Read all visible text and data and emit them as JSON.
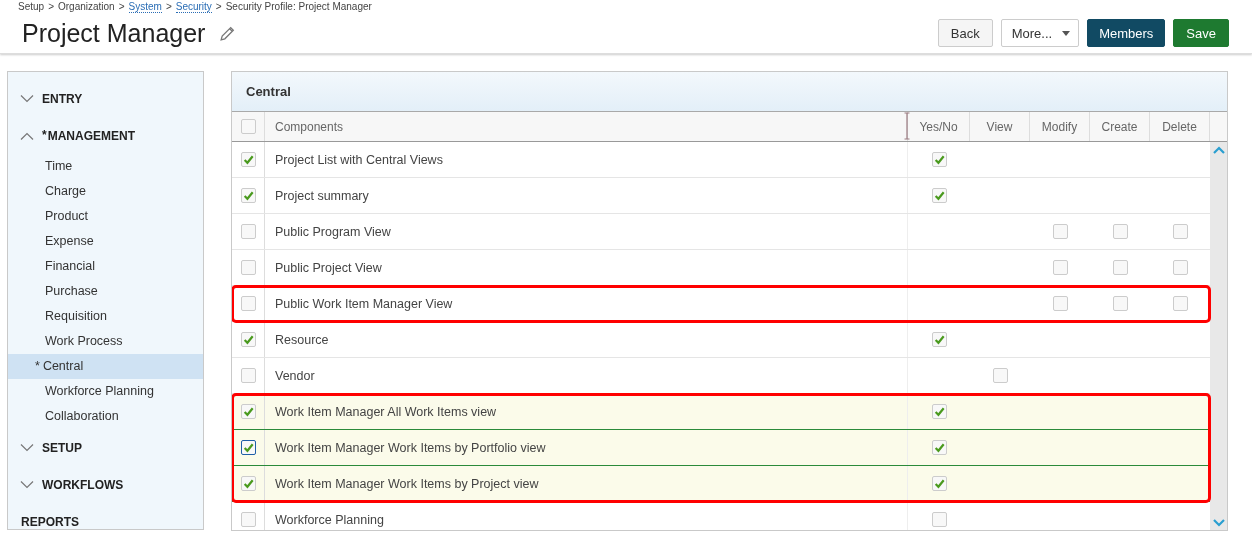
{
  "breadcrumb": {
    "separator": ">",
    "items": [
      {
        "label": "Setup",
        "link": false
      },
      {
        "label": "Organization",
        "link": false
      },
      {
        "label": "System",
        "link": true
      },
      {
        "label": "Security",
        "link": true
      },
      {
        "label": "Security Profile: Project Manager",
        "link": false
      }
    ]
  },
  "title": "Project Manager",
  "buttons": [
    {
      "label": "Back",
      "kind": "plain"
    },
    {
      "label": "More...",
      "kind": "dropdown"
    },
    {
      "label": "Members",
      "kind": "dark"
    },
    {
      "label": "Save",
      "kind": "primary"
    }
  ],
  "sidebar": [
    {
      "label": "ENTRY",
      "kind": "section",
      "expanded": false
    },
    {
      "label": "MANAGEMENT",
      "kind": "section",
      "expanded": true,
      "marker": "*",
      "items": [
        {
          "label": "Time",
          "selected": false
        },
        {
          "label": "Charge",
          "selected": false
        },
        {
          "label": "Product",
          "selected": false
        },
        {
          "label": "Expense",
          "selected": false
        },
        {
          "label": "Financial",
          "selected": false
        },
        {
          "label": "Purchase",
          "selected": false
        },
        {
          "label": "Requisition",
          "selected": false
        },
        {
          "label": "Work Process",
          "selected": false
        },
        {
          "label": "Central",
          "selected": true,
          "marker": "*"
        },
        {
          "label": "Workforce Planning",
          "selected": false
        },
        {
          "label": "Collaboration",
          "selected": false
        }
      ]
    },
    {
      "label": "SETUP",
      "kind": "section",
      "expanded": false
    },
    {
      "label": "WORKFLOWS",
      "kind": "section",
      "expanded": false
    },
    {
      "label": "REPORTS",
      "kind": "link"
    }
  ],
  "panel": {
    "title": "Central",
    "select_all": {
      "checked": false
    },
    "columns": [
      "Components",
      "Yes/No",
      "View",
      "Modify",
      "Create",
      "Delete"
    ],
    "row_groups": [
      {
        "outlined": false,
        "rows": [
          {
            "name": "Project List with Central Views",
            "checked": true,
            "highlighted": false,
            "focused": false,
            "yes_no": true
          },
          {
            "name": "Project summary",
            "checked": true,
            "highlighted": false,
            "focused": false,
            "yes_no": true
          },
          {
            "name": "Public Program View",
            "checked": false,
            "highlighted": false,
            "focused": false,
            "modify": false,
            "create": false,
            "delete": false
          },
          {
            "name": "Public Project View",
            "checked": false,
            "highlighted": false,
            "focused": false,
            "modify": false,
            "create": false,
            "delete": false
          }
        ]
      },
      {
        "outlined": true,
        "rows": [
          {
            "name": "Public Work Item Manager View",
            "checked": false,
            "highlighted": false,
            "focused": false,
            "modify": false,
            "create": false,
            "delete": false
          }
        ]
      },
      {
        "outlined": false,
        "rows": [
          {
            "name": "Resource",
            "checked": true,
            "highlighted": false,
            "focused": false,
            "yes_no": true
          },
          {
            "name": "Vendor",
            "checked": false,
            "highlighted": false,
            "focused": false,
            "view": false
          }
        ]
      },
      {
        "outlined": true,
        "rows": [
          {
            "name": "Work Item Manager All Work Items view",
            "checked": true,
            "highlighted": true,
            "focused": false,
            "yes_no": true
          },
          {
            "name": "Work Item Manager Work Items by Portfolio view",
            "checked": true,
            "highlighted": true,
            "focused": true,
            "yes_no": true
          },
          {
            "name": "Work Item Manager Work Items by Project view",
            "checked": true,
            "highlighted": true,
            "focused": false,
            "yes_no": true
          }
        ]
      },
      {
        "outlined": false,
        "rows": [
          {
            "name": "Workforce Planning",
            "checked": false,
            "highlighted": false,
            "focused": false,
            "yes_no": false
          }
        ]
      }
    ]
  }
}
